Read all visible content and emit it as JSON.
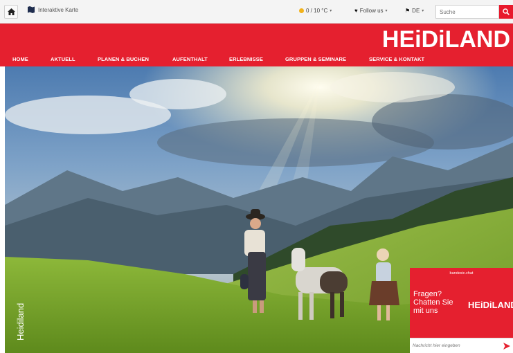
{
  "topbar": {
    "home_icon": "home-icon",
    "map_icon": "map-icon",
    "map_label": "Interaktive Karte",
    "weather": "0 / 10 °C",
    "follow_label": "Follow us",
    "language": "DE",
    "search_placeholder": "Suche",
    "search_icon": "search-icon"
  },
  "header": {
    "logo": "HEiDiLAND",
    "brand_color": "#e5202f"
  },
  "nav": {
    "items": [
      {
        "label": "HOME"
      },
      {
        "label": "AKTUELL"
      },
      {
        "label": "PLANEN & BUCHEN"
      },
      {
        "label": "AUFENTHALT"
      },
      {
        "label": "ERLEBNISSE"
      },
      {
        "label": "GRUPPEN & SEMINARE"
      },
      {
        "label": "SERVICE & KONTAKT"
      }
    ]
  },
  "hero": {
    "credit": "Heidiland"
  },
  "chat": {
    "powered_by": "bandesic.chat",
    "prompt_line1": "Fragen?",
    "prompt_line2": "Chatten Sie",
    "prompt_line3": "mit uns",
    "logo": "HEiDiLAND",
    "input_placeholder": "Nachricht hier eingeben",
    "send_icon": "send-arrow-icon"
  }
}
